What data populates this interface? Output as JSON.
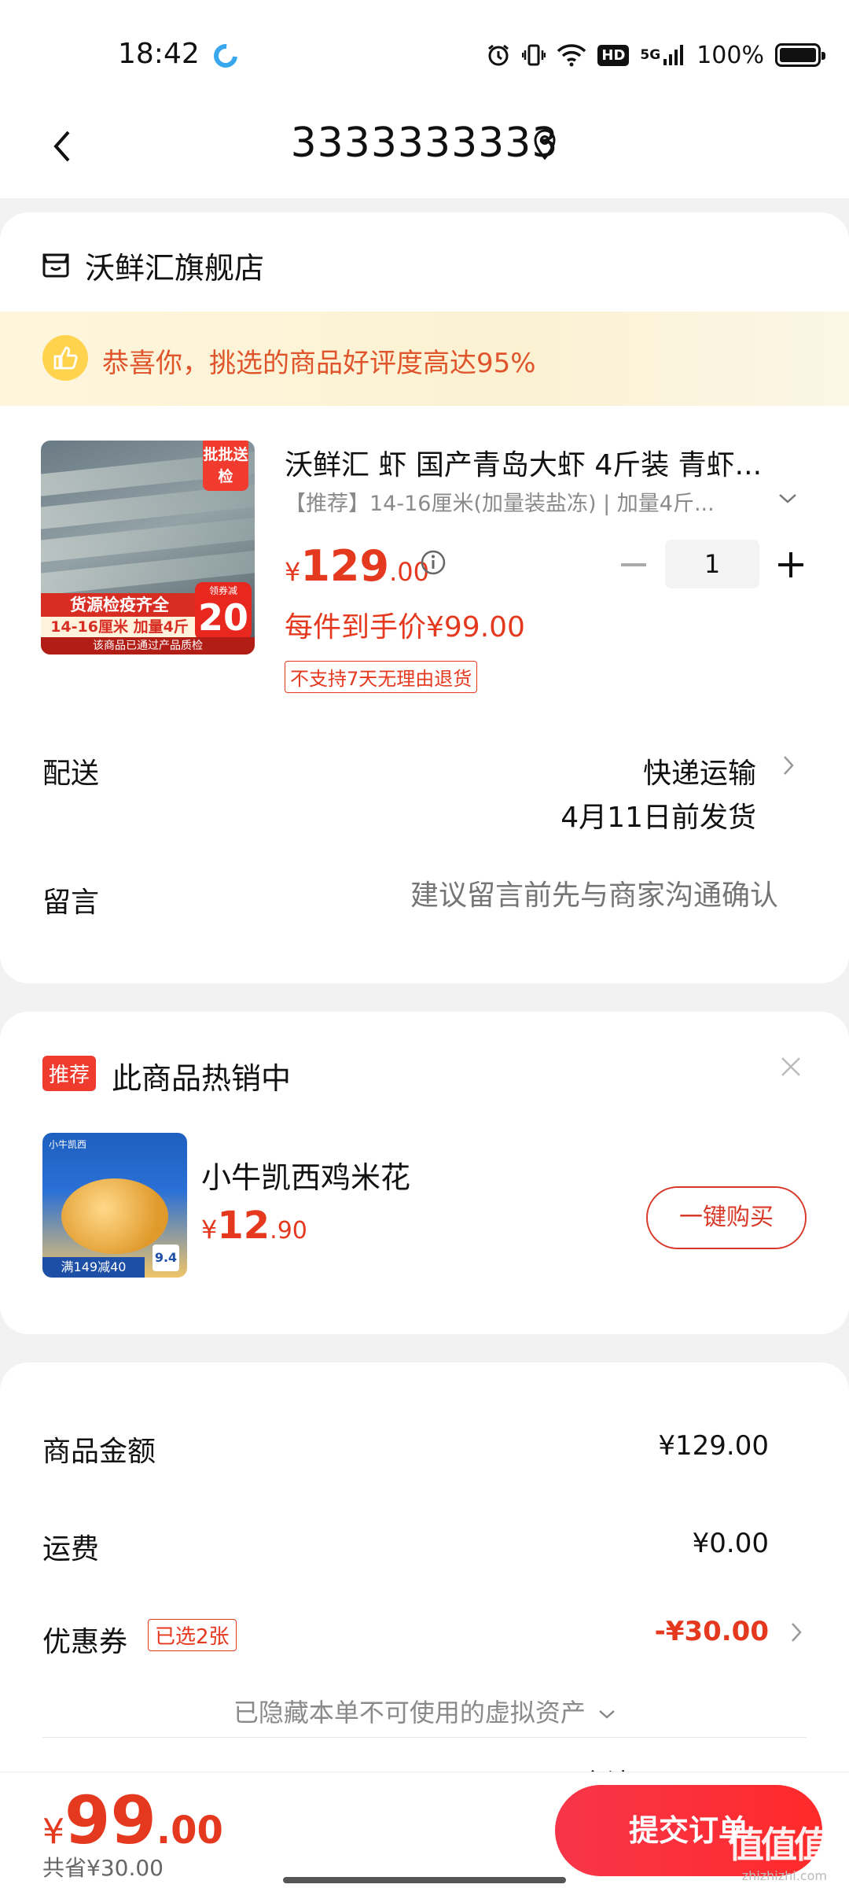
{
  "status_bar": {
    "time": "18:42",
    "battery_text": "100%",
    "network": "5G",
    "hd": "HD",
    "icons": [
      "alarm-icon",
      "vibrate-icon",
      "wifi-icon",
      "hd-icon",
      "signal-icon",
      "battery-icon"
    ]
  },
  "nav": {
    "title": "3333333333"
  },
  "shop": {
    "name": "沃鲜汇旗舰店",
    "promo": "恭喜你，挑选的商品好评度高达95%"
  },
  "product": {
    "image_corner": "批批送检",
    "image_band1": "货源检疫齐全",
    "image_band2": "14-16厘米 加量4斤",
    "image_coupon_top": "领券减",
    "image_coupon_num": "20",
    "image_foot": "该商品已通过产品质检",
    "title": "沃鲜汇 虾 国产青岛大虾 4斤装 青虾...",
    "spec": "【推荐】14-16厘米(加量装盐冻) | 加量4斤...",
    "price_symbol": "¥",
    "price_int": "129",
    "price_dec": ".00",
    "quantity": "1",
    "final_price": "每件到手价¥99.00",
    "return_policy": "不支持7天无理由退货"
  },
  "delivery": {
    "label": "配送",
    "method": "快递运输",
    "date": "4月11日前发货"
  },
  "message": {
    "label": "留言",
    "placeholder": "建议留言前先与商家沟通确认"
  },
  "recommend": {
    "badge": "推荐",
    "title": "此商品热销中",
    "item_name": "小牛凯西鸡米花",
    "price_symbol": "¥",
    "price_int": "12",
    "price_dec": ".90",
    "buy_label": "一键购买",
    "image_top": "小牛凯西",
    "image_foot": "满149减40",
    "image_score": "9.4"
  },
  "summary": {
    "goods_label": "商品金额",
    "goods_value": "¥129.00",
    "shipping_label": "运费",
    "shipping_value": "¥0.00",
    "coupon_label": "优惠券",
    "coupon_tag": "已选2张",
    "coupon_value": "-¥30.00",
    "hidden_assets": "已隐藏本单不可使用的虚拟资产",
    "peek": "合计"
  },
  "bottom": {
    "total_symbol": "¥",
    "total_int": "99",
    "total_dec": ".00",
    "saved": "共省¥30.00",
    "submit_label": "提交订单",
    "watermark": "值值值",
    "watermark_sub": "zhizhizhi.com"
  },
  "colors": {
    "accent_red": "#e5391f",
    "promo_bg": "#fdf6dd",
    "promo_text": "#e0542b",
    "submit_gradient_start": "#f7354a",
    "submit_gradient_end": "#ff2a2a"
  }
}
